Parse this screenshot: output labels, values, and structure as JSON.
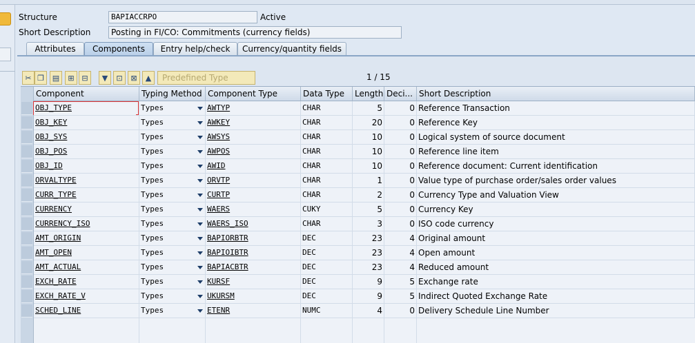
{
  "header": {
    "structure_label": "Structure",
    "structure_value": "BAPIACCRPO",
    "status": "Active",
    "short_desc_label": "Short Description",
    "short_desc_value": "Posting in FI/CO: Commitments (currency fields)"
  },
  "tabs": [
    {
      "label": "Attributes",
      "active": false
    },
    {
      "label": "Components",
      "active": true
    },
    {
      "label": "Entry help/check",
      "active": false
    },
    {
      "label": "Currency/quantity fields",
      "active": false
    }
  ],
  "toolbar": {
    "predefined_type_label": "Predefined Type",
    "icons": [
      "cut-icon",
      "copy-icon",
      "paste-icon",
      "insert-row-icon",
      "delete-row-icon",
      "filter-icon",
      "find-icon",
      "find-next-icon",
      "up-icon"
    ]
  },
  "pager": "1 / 15",
  "columns": [
    "Component",
    "Typing Method",
    "Component Type",
    "Data Type",
    "Length",
    "Deci...",
    "Short Description"
  ],
  "rows": [
    {
      "component": "OBJ_TYPE",
      "typing": "Types",
      "comp_type": "AWTYP",
      "data_type": "CHAR",
      "length": "5",
      "deci": "0",
      "desc": "Reference Transaction"
    },
    {
      "component": "OBJ_KEY",
      "typing": "Types",
      "comp_type": "AWKEY",
      "data_type": "CHAR",
      "length": "20",
      "deci": "0",
      "desc": "Reference Key"
    },
    {
      "component": "OBJ_SYS",
      "typing": "Types",
      "comp_type": "AWSYS",
      "data_type": "CHAR",
      "length": "10",
      "deci": "0",
      "desc": "Logical system of source document"
    },
    {
      "component": "OBJ_POS",
      "typing": "Types",
      "comp_type": "AWPOS",
      "data_type": "CHAR",
      "length": "10",
      "deci": "0",
      "desc": "Reference line item"
    },
    {
      "component": "OBJ_ID",
      "typing": "Types",
      "comp_type": "AWID",
      "data_type": "CHAR",
      "length": "10",
      "deci": "0",
      "desc": "Reference document: Current identification"
    },
    {
      "component": "ORVALTYPE",
      "typing": "Types",
      "comp_type": "ORVTP",
      "data_type": "CHAR",
      "length": "1",
      "deci": "0",
      "desc": "Value type of purchase order/sales order values"
    },
    {
      "component": "CURR_TYPE",
      "typing": "Types",
      "comp_type": "CURTP",
      "data_type": "CHAR",
      "length": "2",
      "deci": "0",
      "desc": "Currency Type and Valuation View"
    },
    {
      "component": "CURRENCY",
      "typing": "Types",
      "comp_type": "WAERS",
      "data_type": "CUKY",
      "length": "5",
      "deci": "0",
      "desc": "Currency Key"
    },
    {
      "component": "CURRENCY_ISO",
      "typing": "Types",
      "comp_type": "WAERS_ISO",
      "data_type": "CHAR",
      "length": "3",
      "deci": "0",
      "desc": "ISO code currency"
    },
    {
      "component": "AMT_ORIGIN",
      "typing": "Types",
      "comp_type": "BAPIORBTR",
      "data_type": "DEC",
      "length": "23",
      "deci": "4",
      "desc": "Original amount"
    },
    {
      "component": "AMT_OPEN",
      "typing": "Types",
      "comp_type": "BAPIOIBTR",
      "data_type": "DEC",
      "length": "23",
      "deci": "4",
      "desc": "Open amount"
    },
    {
      "component": "AMT_ACTUAL",
      "typing": "Types",
      "comp_type": "BAPIACBTR",
      "data_type": "DEC",
      "length": "23",
      "deci": "4",
      "desc": "Reduced amount"
    },
    {
      "component": "EXCH_RATE",
      "typing": "Types",
      "comp_type": "KURSF",
      "data_type": "DEC",
      "length": "9",
      "deci": "5",
      "desc": "Exchange rate"
    },
    {
      "component": "EXCH_RATE_V",
      "typing": "Types",
      "comp_type": "UKURSM",
      "data_type": "DEC",
      "length": "9",
      "deci": "5",
      "desc": "Indirect Quoted Exchange Rate"
    },
    {
      "component": "SCHED_LINE",
      "typing": "Types",
      "comp_type": "ETENR",
      "data_type": "NUMC",
      "length": "4",
      "deci": "0",
      "desc": "Delivery Schedule Line Number"
    }
  ]
}
